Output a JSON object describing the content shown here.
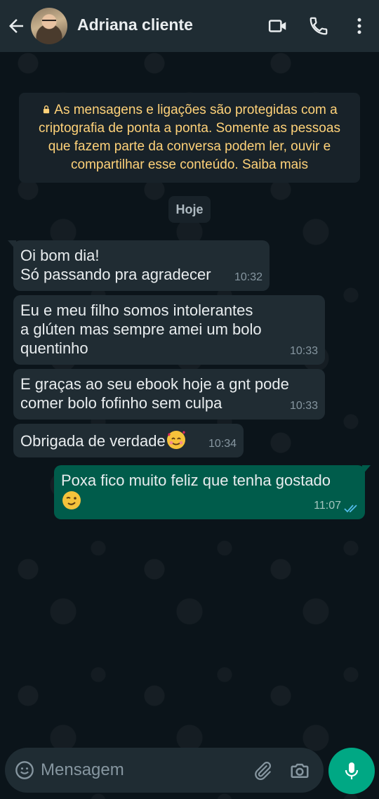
{
  "header": {
    "contact_name": "Adriana cliente",
    "icons": [
      "back-arrow-icon",
      "video-call-icon",
      "voice-call-icon",
      "more-options-icon"
    ]
  },
  "encryption_notice": "As mensagens e ligações são protegidas com a criptografia de ponta a ponta. Somente as pessoas que fazem parte da conversa podem ler, ouvir e compartilhar esse conteúdo. Saiba mais",
  "date_chip": "Hoje",
  "messages": [
    {
      "direction": "in",
      "text": "Oi bom dia!\nSó passando pra agradecer",
      "time": "10:32"
    },
    {
      "direction": "in",
      "text": "Eu e meu filho somos intolerantes\na glúten mas sempre amei um bolo\nquentinho",
      "time": "10:33"
    },
    {
      "direction": "in",
      "text": "E graças ao seu ebook hoje a gnt pode\ncomer bolo fofinho sem culpa",
      "time": "10:33"
    },
    {
      "direction": "in",
      "text": "Obrigada de verdade",
      "emoji": "smiling-face-with-hearts",
      "time": "10:34"
    },
    {
      "direction": "out",
      "text": "Poxa fico muito feliz que tenha gostado",
      "emoji": "winking-face",
      "time": "11:07",
      "status": "read"
    }
  ],
  "composer": {
    "placeholder": "Mensagem",
    "icons": [
      "emoji-icon",
      "attach-icon",
      "camera-icon",
      "microphone-icon"
    ]
  },
  "colors": {
    "background": "#0b141a",
    "header": "#1f2c33",
    "incoming_bubble": "#202c33",
    "outgoing_bubble": "#005c4b",
    "notice_text": "#ffd279",
    "accent": "#00a884",
    "read_ticks": "#53bdeb"
  }
}
